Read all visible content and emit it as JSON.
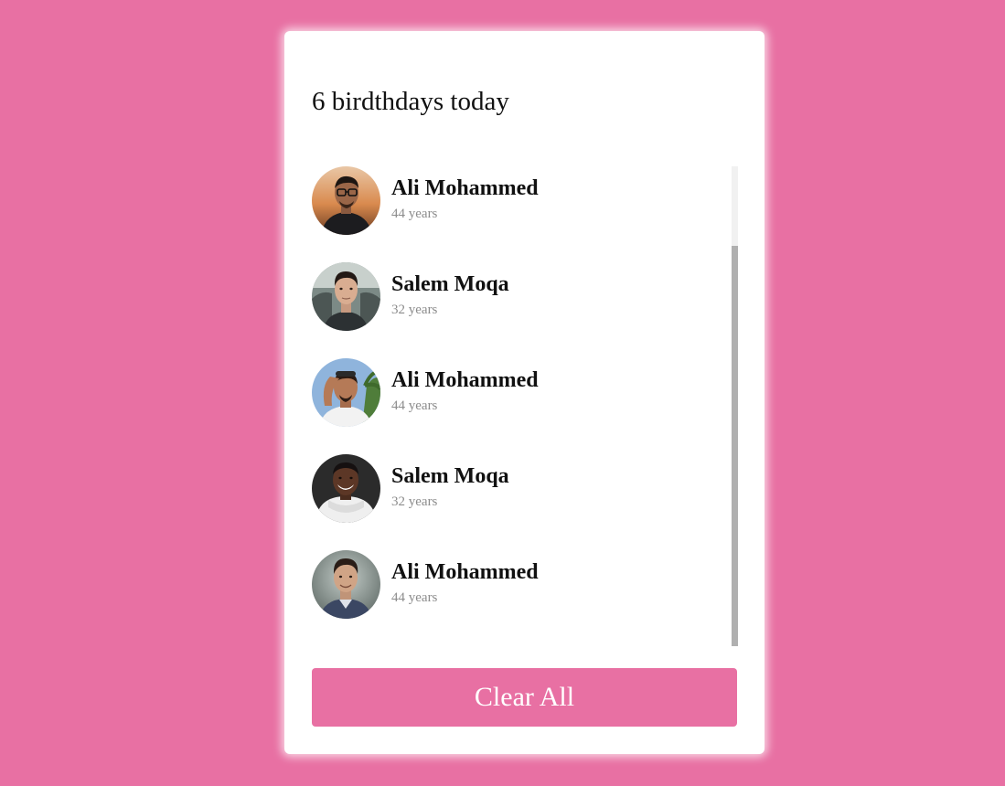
{
  "page": {
    "background_color": "#e870a3",
    "accent_color": "#e870a3"
  },
  "card": {
    "title": "6 birdthdays today",
    "people": [
      {
        "name": "Ali Mohammed",
        "age": "44 years",
        "avatar_icon": "person-photo-sunset"
      },
      {
        "name": "Salem Moqa",
        "age": "32 years",
        "avatar_icon": "person-photo-car"
      },
      {
        "name": "Ali Mohammed",
        "age": "44 years",
        "avatar_icon": "person-photo-palm"
      },
      {
        "name": "Salem Moqa",
        "age": "32 years",
        "avatar_icon": "person-photo-hoodie"
      },
      {
        "name": "Ali Mohammed",
        "age": "44 years",
        "avatar_icon": "person-photo-studio"
      }
    ],
    "clear_button_label": "Clear All"
  }
}
